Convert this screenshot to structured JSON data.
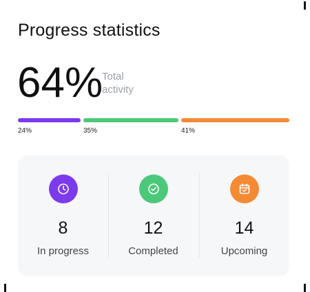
{
  "card": {
    "title": "Progress statistics",
    "total": {
      "value": "64%",
      "label": "Total activity"
    }
  },
  "progress": [
    {
      "label": "24%",
      "color": "#7c3aed"
    },
    {
      "label": "35%",
      "color": "#4cc87a"
    },
    {
      "label": "41%",
      "color": "#f58a35"
    }
  ],
  "stats": [
    {
      "icon": "clock-icon",
      "value": "8",
      "label": "In progress",
      "color": "#7c3aed"
    },
    {
      "icon": "check-circle-icon",
      "value": "12",
      "label": "Completed",
      "color": "#4cc87a"
    },
    {
      "icon": "calendar-icon",
      "value": "14",
      "label": "Upcoming",
      "color": "#f58a35"
    }
  ]
}
